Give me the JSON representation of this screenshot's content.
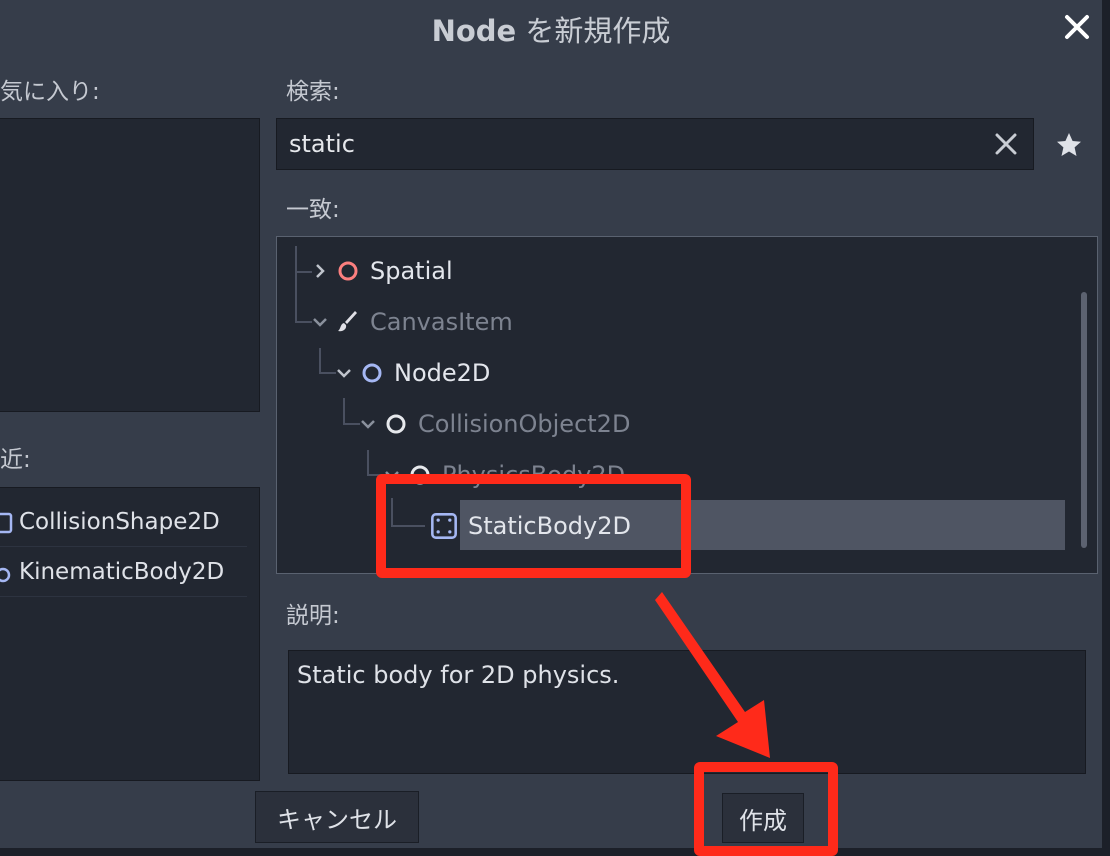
{
  "dialog": {
    "title_bold": "Node",
    "title_rest": " を新規作成",
    "close_icon": "close-icon"
  },
  "favorites": {
    "label": "気に入り:"
  },
  "recent": {
    "label": "近:",
    "items": [
      {
        "label": "CollisionShape2D",
        "icon": "collision-shape-icon"
      },
      {
        "label": "KinematicBody2D",
        "icon": "kinematic-body-icon"
      }
    ]
  },
  "search": {
    "label": "検索:",
    "value": "static",
    "clear_icon": "clear-icon",
    "favorite_icon": "star-icon"
  },
  "matches": {
    "label": "一致:",
    "items": [
      {
        "label": "Spatial",
        "icon": "spatial-icon",
        "expanded": false,
        "enabled": true,
        "color": "#fc7f7f"
      },
      {
        "label": "CanvasItem",
        "icon": "brush-icon",
        "expanded": true,
        "enabled": false,
        "color": "#e0e0e0"
      },
      {
        "label": "Node2D",
        "icon": "node2d-icon",
        "expanded": true,
        "enabled": true,
        "color": "#a5b7f3"
      },
      {
        "label": "CollisionObject2D",
        "icon": "collision-object-icon",
        "expanded": true,
        "enabled": false,
        "color": "#e0e0e0"
      },
      {
        "label": "PhysicsBody2D",
        "icon": "physics-body-icon",
        "expanded": true,
        "enabled": false,
        "color": "#e0e0e0"
      },
      {
        "label": "StaticBody2D",
        "icon": "static-body-icon",
        "expanded": false,
        "enabled": true,
        "selected": true,
        "color": "#a5b7f3"
      }
    ]
  },
  "description": {
    "label": "説明:",
    "text": "Static body for 2D physics."
  },
  "buttons": {
    "cancel": "キャンセル",
    "create": "作成"
  },
  "annotation": {
    "color": "#ff2a1a"
  }
}
